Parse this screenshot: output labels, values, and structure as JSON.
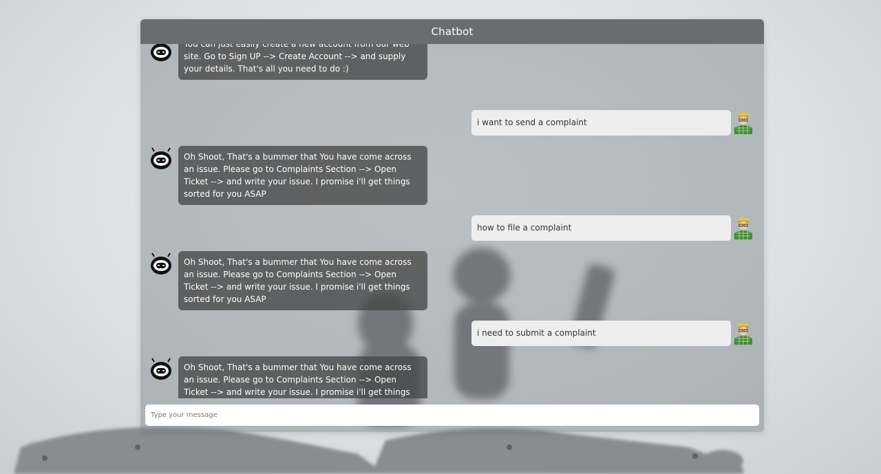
{
  "header": {
    "title": "Chatbot"
  },
  "messages": [
    {
      "from": "bot",
      "text": "You can just easily create a new account from our web site. Go to Sign UP --> Create Account --> and supply your details. That's all you need to do :)"
    },
    {
      "from": "user",
      "text": "i want to send a complaint"
    },
    {
      "from": "bot",
      "text": "Oh Shoot, That's a bummer that You have come across an issue. Please go to Complaints Section --> Open Ticket --> and write your issue. I promise i'll get things sorted for you ASAP"
    },
    {
      "from": "user",
      "text": "how to file a complaint"
    },
    {
      "from": "bot",
      "text": "Oh Shoot, That's a bummer that You have come across an issue. Please go to Complaints Section --> Open Ticket --> and write your issue. I promise i'll get things sorted for you ASAP"
    },
    {
      "from": "user",
      "text": "i need to submit a complaint"
    },
    {
      "from": "bot",
      "text": "Oh Shoot, That's a bummer that You have come across an issue. Please go to Complaints Section --> Open Ticket --> and write your issue. I promise i'll get things sorted for you ASAP"
    }
  ],
  "input": {
    "placeholder": "Type your message",
    "value": ""
  },
  "icons": {
    "bot": "robot-face-icon",
    "user": "user-avatar-icon"
  }
}
